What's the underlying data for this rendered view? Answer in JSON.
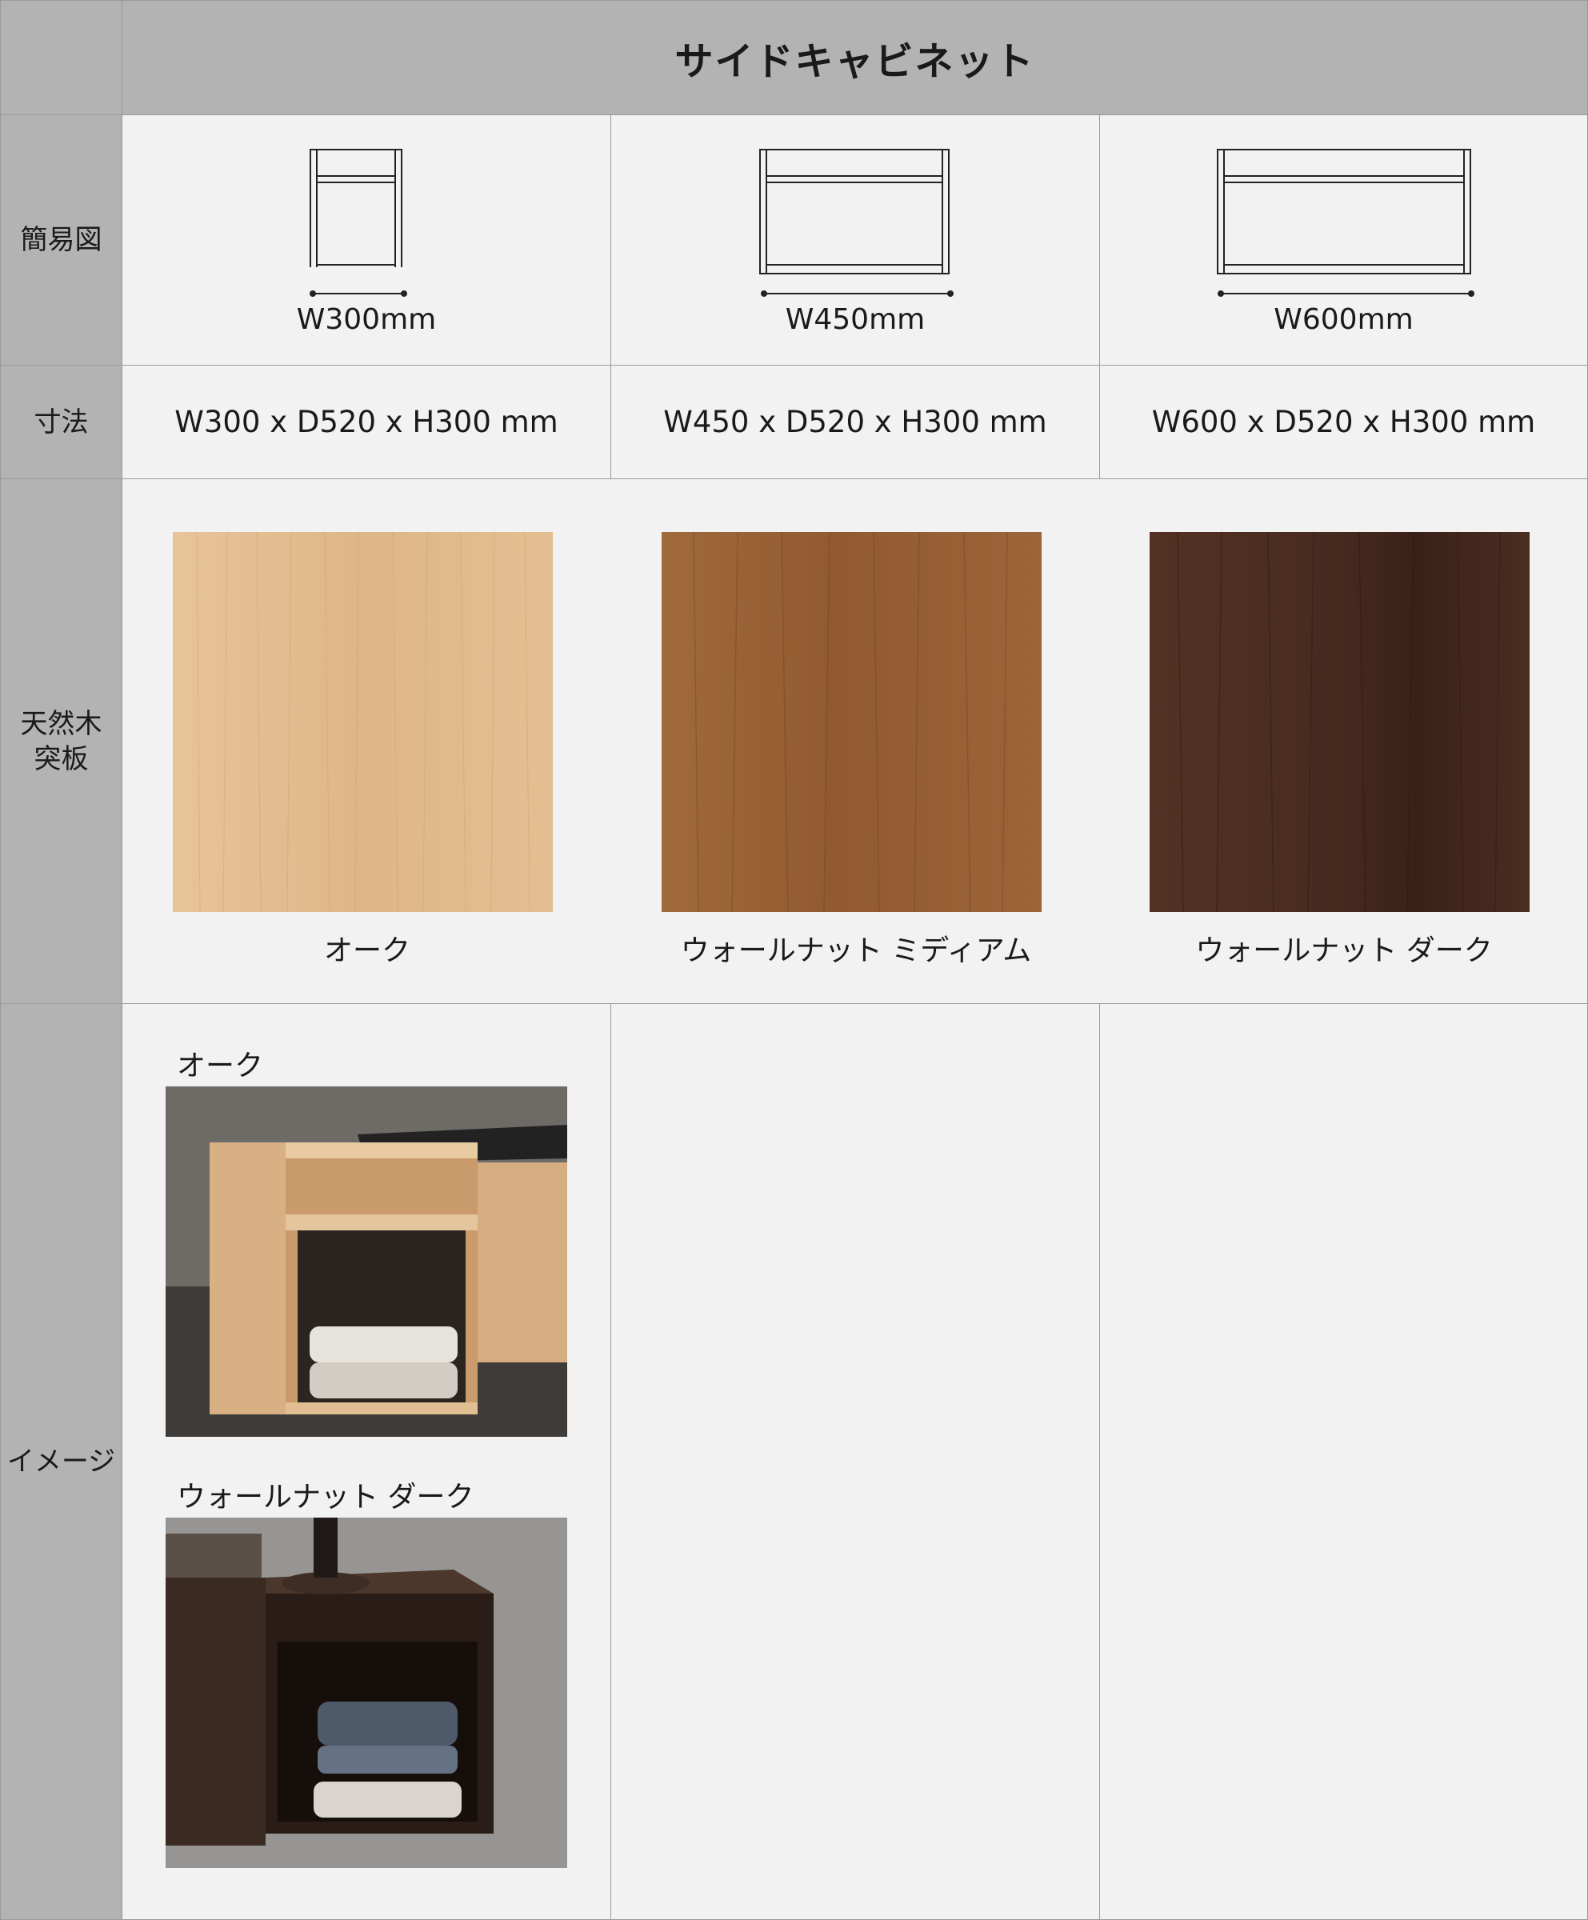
{
  "header": {
    "title": "サイドキャビネット"
  },
  "rows": {
    "diagram": "簡易図",
    "dimensions": "寸法",
    "veneer_line1": "天然木",
    "veneer_line2": "突板",
    "image": "イメージ"
  },
  "columns": [
    {
      "diagram_label": "W300mm",
      "dimensions": "W300 x D520 x H300 mm",
      "finish": "オーク"
    },
    {
      "diagram_label": "W450mm",
      "dimensions": "W450 x D520 x H300 mm",
      "finish": "ウォールナット ミディアム"
    },
    {
      "diagram_label": "W600mm",
      "dimensions": "W600 x D520 x H300 mm",
      "finish": "ウォールナット ダーク"
    }
  ],
  "images": [
    {
      "label": "オーク"
    },
    {
      "label": "ウォールナット ダーク"
    }
  ],
  "colors": {
    "header_bg": "#b3b3b3",
    "body_bg": "#f2f2f2",
    "oak": "#e2bb8d",
    "walnut_medium": "#9a6236",
    "walnut_dark": "#4a2b20"
  }
}
